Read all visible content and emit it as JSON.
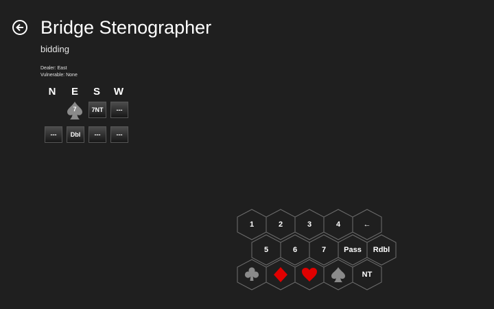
{
  "header": {
    "title": "Bridge Stenographer",
    "subtitle": "bidding"
  },
  "deal_info": {
    "dealer": "Dealer:  East",
    "vulnerable": "Vulnerable:  None"
  },
  "seats": [
    "N",
    "E",
    "S",
    "W"
  ],
  "auction": {
    "row1": {
      "east": {
        "level": "7",
        "suit": "spade-icon"
      },
      "south": "7NT",
      "west": "---"
    },
    "row2": {
      "north": "---",
      "east": "Dbl",
      "south": "---",
      "west": "---"
    }
  },
  "keypad": {
    "row1": [
      "1",
      "2",
      "3",
      "4",
      "←"
    ],
    "row2": [
      "5",
      "6",
      "7",
      "Pass",
      "Rdbl"
    ],
    "row3_nt": "NT",
    "suits": [
      "club-icon",
      "diamond-icon",
      "heart-icon",
      "spade-icon"
    ]
  },
  "colors": {
    "background": "#1f1f1f",
    "text": "#ffffff",
    "hex_border": "#6f6f6f",
    "red_suit": "#e00000",
    "black_suit": "#8a8a8a"
  }
}
